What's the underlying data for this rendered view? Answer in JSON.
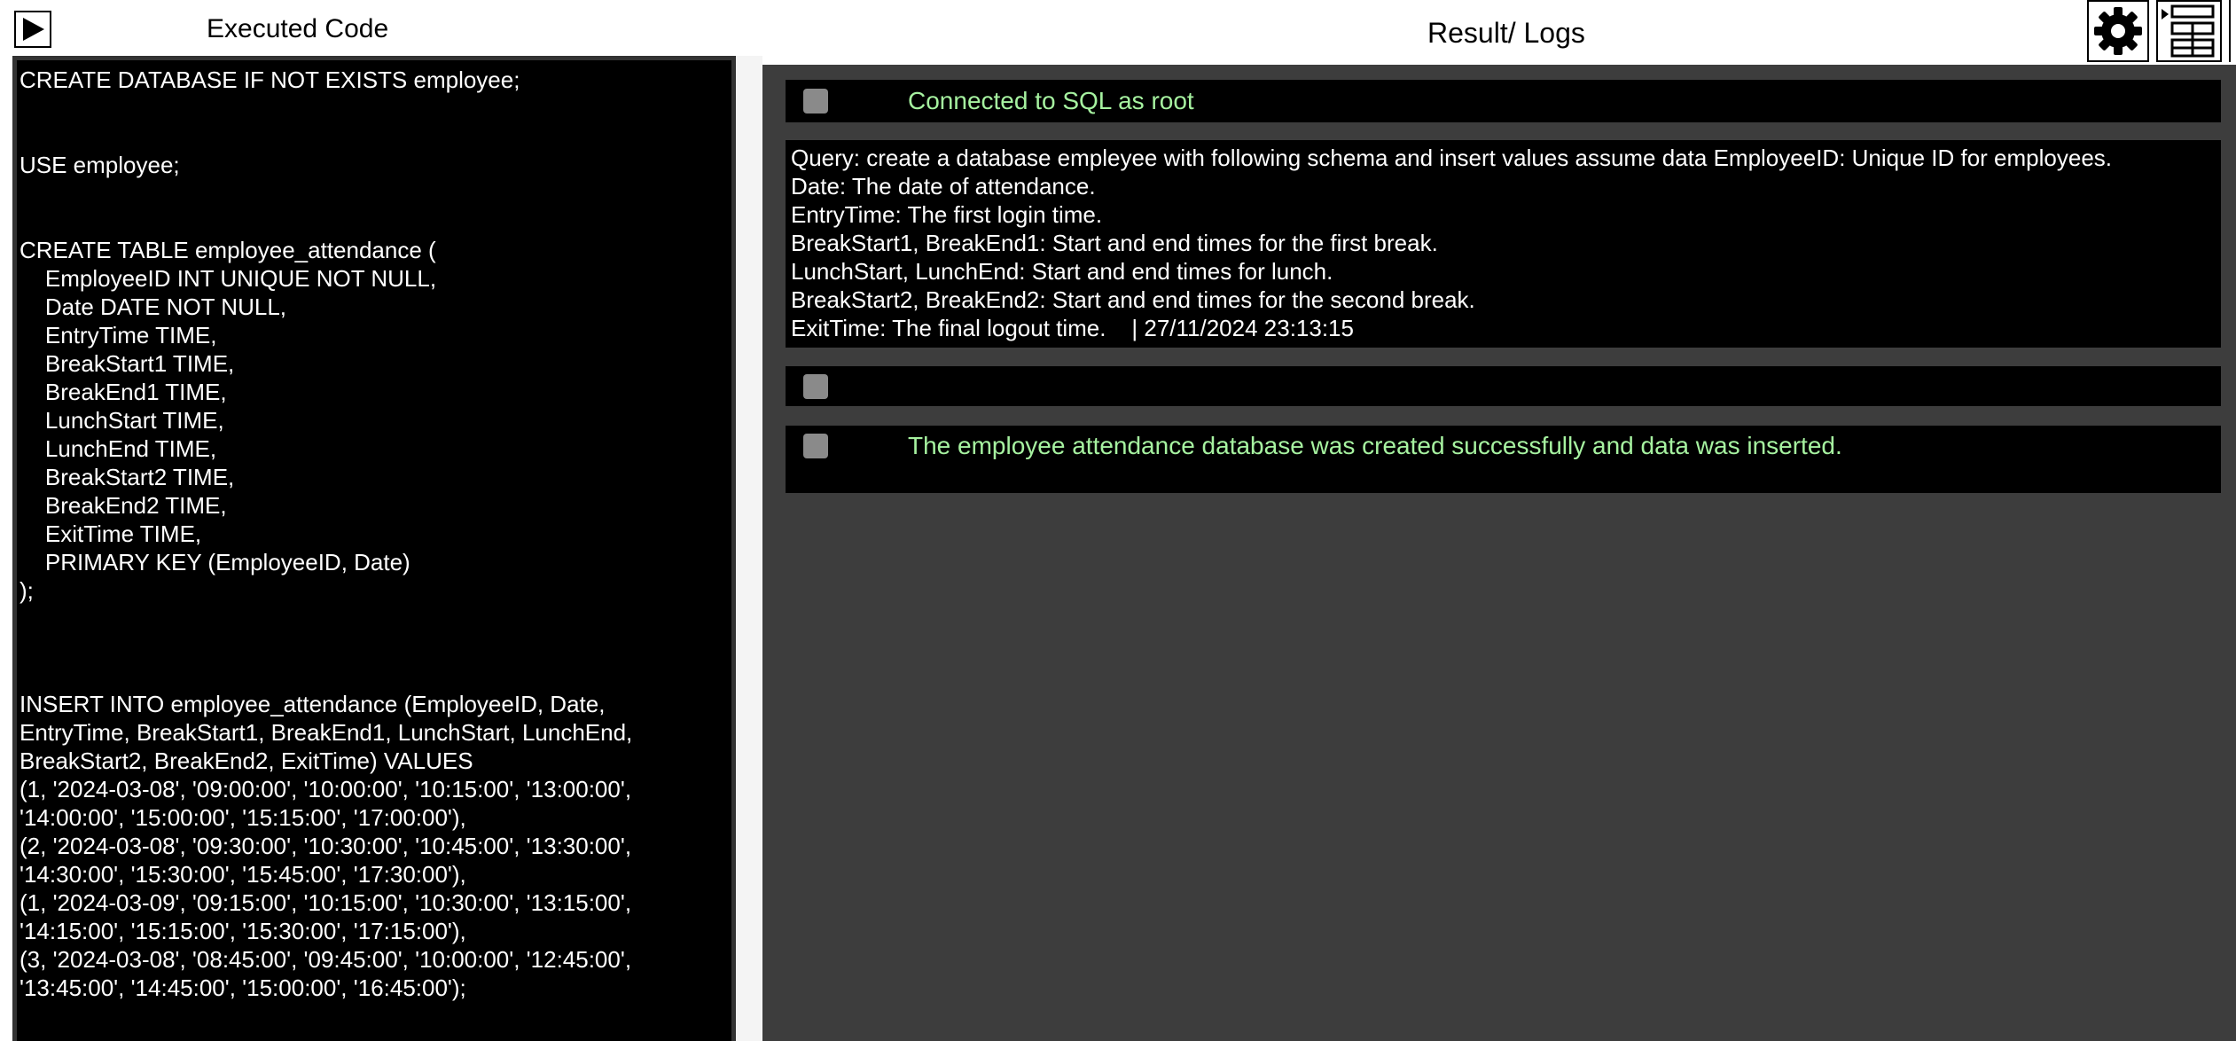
{
  "left_pane": {
    "title": "Executed Code",
    "run_icon": "play-icon",
    "code": "CREATE DATABASE IF NOT EXISTS employee;\n\n\nUSE employee;\n\n\nCREATE TABLE employee_attendance (\n    EmployeeID INT UNIQUE NOT NULL,\n    Date DATE NOT NULL,\n    EntryTime TIME,\n    BreakStart1 TIME,\n    BreakEnd1 TIME,\n    LunchStart TIME,\n    LunchEnd TIME,\n    BreakStart2 TIME,\n    BreakEnd2 TIME,\n    ExitTime TIME,\n    PRIMARY KEY (EmployeeID, Date)\n);\n\n\n\nINSERT INTO employee_attendance (EmployeeID, Date,\nEntryTime, BreakStart1, BreakEnd1, LunchStart, LunchEnd,\nBreakStart2, BreakEnd2, ExitTime) VALUES\n(1, '2024-03-08', '09:00:00', '10:00:00', '10:15:00', '13:00:00',\n'14:00:00', '15:00:00', '15:15:00', '17:00:00'),\n(2, '2024-03-08', '09:30:00', '10:30:00', '10:45:00', '13:30:00',\n'14:30:00', '15:30:00', '15:45:00', '17:30:00'),\n(1, '2024-03-09', '09:15:00', '10:15:00', '10:30:00', '13:15:00',\n'14:15:00', '15:15:00', '15:30:00', '17:15:00'),\n(3, '2024-03-08', '08:45:00', '09:45:00', '10:00:00', '12:45:00',\n'13:45:00', '14:45:00', '15:00:00', '16:45:00');"
  },
  "right_pane": {
    "title": "Result/ Logs",
    "settings_icon": "gear-icon",
    "table_icon": "table-icon",
    "entries": [
      {
        "text": "Connected to SQL as root"
      },
      {
        "text": "Query: create a database empleyee with following schema and insert values assume data EmployeeID: Unique ID for employees.\nDate: The date of attendance.\nEntryTime: The first login time.\nBreakStart1, BreakEnd1: Start and end times for the first break.\nLunchStart, LunchEnd: Start and end times for lunch.\nBreakStart2, BreakEnd2: Start and end times for the second break.\nExitTime: The final logout time.    | 27/11/2024 23:13:15"
      },
      {
        "text": ""
      },
      {
        "text": "The employee attendance database was created successfully and data was inserted."
      }
    ]
  },
  "colors": {
    "code_bg": "#000000",
    "code_text": "#ffffff",
    "results_bg": "#3d3d3d",
    "success_text": "#a6f2a0",
    "checkbox": "#8a8a8a"
  }
}
